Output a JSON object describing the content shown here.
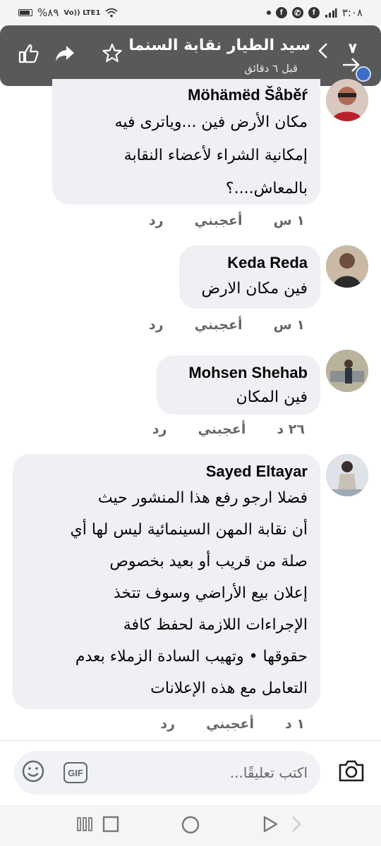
{
  "status_bar": {
    "time": "٣:٠٨",
    "battery": "%٨٩",
    "network": "Vo)) LTE1",
    "speed": "٤٠ ٢٠"
  },
  "header": {
    "title": "سيد الطيار نقابة السنما",
    "subtitle": "قبل ٦ دقائق",
    "reaction_count": "٧"
  },
  "comments": [
    {
      "author": "Möhämëd Šåběŕ",
      "text": "مكان الأرض فين ...وياترى فيه\nإمكانية الشراء لأعضاء النقابة\nبالمعاش....؟",
      "time": "١ س",
      "like": "أعجبني",
      "reply": "رد"
    },
    {
      "author": "Keda Reda",
      "text": "فين مكان الارض",
      "time": "١ س",
      "like": "أعجبني",
      "reply": "رد"
    },
    {
      "author": "Mohsen Shehab",
      "text": "فين المكان",
      "time": "٢٦ د",
      "like": "أعجبني",
      "reply": "رد"
    },
    {
      "author": "Sayed Eltayar",
      "text": "فضلا ارجو رفع هذا المنشور حيث\nأن نقابة المهن السينمائية ليس لها أي\nصلة من قريب أو بعيد بخصوص\nإعلان بيع الأراضي وسوف تتخذ\nالإجراءات اللازمة لحفظ كافة\nحقوقها • وتهيب السادة الزملاء بعدم\nالتعامل مع هذه الإعلانات",
      "time": "١ د",
      "like": "أعجبني",
      "reply": "رد"
    }
  ],
  "composer": {
    "placeholder": "اكتب تعليقًا...",
    "gif_label": "GIF"
  }
}
